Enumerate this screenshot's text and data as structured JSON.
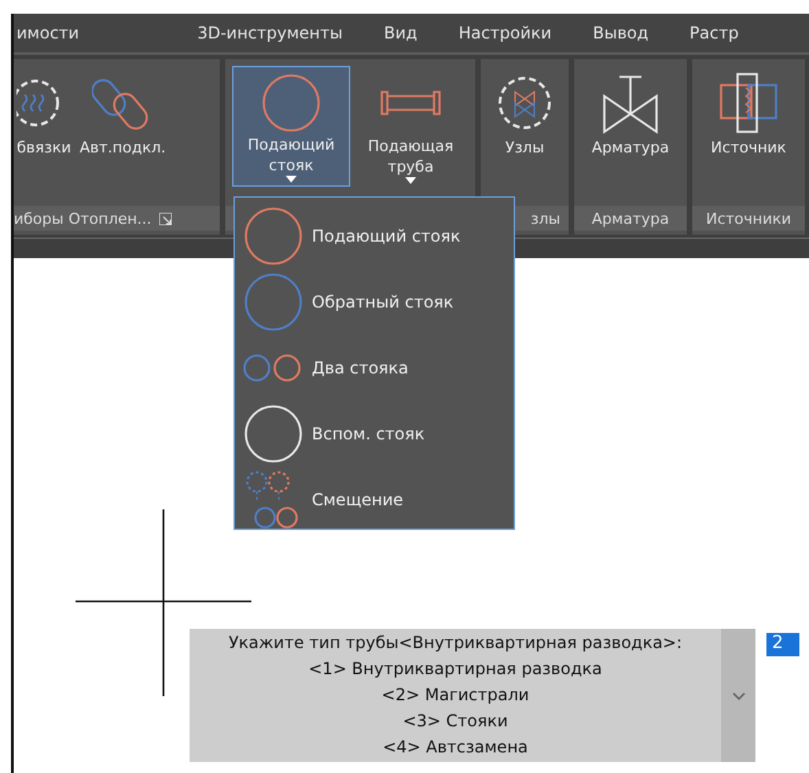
{
  "menu_tabs": [
    {
      "label": "имости"
    },
    {
      "label": "3D-инструменты"
    },
    {
      "label": "Вид"
    },
    {
      "label": "Настройки"
    },
    {
      "label": "Вывод"
    },
    {
      "label": "Растр"
    }
  ],
  "ribbon_panels": [
    {
      "title": "иборы Отоплен...",
      "launcher": true,
      "tools": [
        {
          "label": "бвязки",
          "kind": "gear-heat",
          "dropdown": false,
          "selected": false
        },
        {
          "label": "Авт.подкл.",
          "kind": "link",
          "dropdown": false,
          "selected": false
        }
      ]
    },
    {
      "launcher": false,
      "tools": [
        {
          "label": "Подающий стояк",
          "kind": "supply",
          "dropdown": true,
          "selected": true
        },
        {
          "label": "Подающая труба",
          "kind": "pipe",
          "dropdown": true,
          "selected": false
        }
      ]
    },
    {
      "title": "злы",
      "launcher": false,
      "tools": [
        {
          "label": "Узлы",
          "kind": "gear-valve",
          "dropdown": false,
          "selected": false
        }
      ]
    },
    {
      "title": "Арматура",
      "launcher": false,
      "tools": [
        {
          "label": "Арматура",
          "kind": "valve",
          "dropdown": false,
          "selected": false
        }
      ]
    },
    {
      "title": "Источники",
      "launcher": false,
      "tools": [
        {
          "label": "Источник",
          "kind": "source",
          "dropdown": false,
          "selected": false
        }
      ]
    }
  ],
  "dropdown_menu": {
    "items": [
      {
        "label": "Подающий стояк",
        "kind": "supply"
      },
      {
        "label": "Обратный стояк",
        "kind": "return"
      },
      {
        "label": "Два стояка",
        "kind": "two"
      },
      {
        "label": "Вспом. стояк",
        "kind": "aux"
      },
      {
        "label": "Смещение",
        "kind": "offset"
      }
    ]
  },
  "command_prompt": {
    "lines": [
      "Укажите тип трубы<Внутриквартирная разводка>:",
      "<1> Внутриквартирная разводка",
      "<2> Магистрали",
      "<3> Стояки",
      "<4> Автсзамена"
    ],
    "input_value": "2"
  }
}
